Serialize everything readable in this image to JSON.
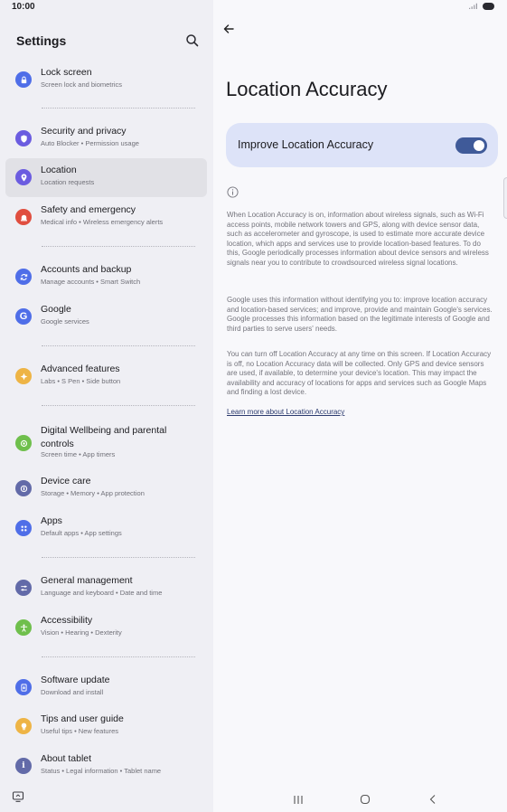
{
  "status_bar": {
    "time": "10:00"
  },
  "settings": {
    "title": "Settings",
    "items": [
      {
        "name": "lock-screen",
        "title": "Lock screen",
        "subtitle": "Screen lock and biometrics",
        "icon": "lock-icon",
        "color": "#4f6ee8"
      },
      {
        "name": "security-privacy",
        "title": "Security and privacy",
        "subtitle": "Auto Blocker  •  Permission usage",
        "icon": "shield-icon",
        "color": "#6b5ce0"
      },
      {
        "name": "location",
        "title": "Location",
        "subtitle": "Location requests",
        "icon": "location-pin-icon",
        "color": "#6b5ce0"
      },
      {
        "name": "safety-emergency",
        "title": "Safety and emergency",
        "subtitle": "Medical info  •  Wireless emergency alerts",
        "icon": "emergency-icon",
        "color": "#e04e3f"
      },
      {
        "name": "accounts-backup",
        "title": "Accounts and backup",
        "subtitle": "Manage accounts  •  Smart Switch",
        "icon": "sync-icon",
        "color": "#4f6ee8"
      },
      {
        "name": "google",
        "title": "Google",
        "subtitle": "Google services",
        "icon": "google-icon",
        "color": "#4f6ee8"
      },
      {
        "name": "advanced-features",
        "title": "Advanced features",
        "subtitle": "Labs  •  S Pen  •  Side button",
        "icon": "star-icon",
        "color": "#eeb445"
      },
      {
        "name": "digital-wellbeing",
        "title": "Digital Wellbeing and parental controls",
        "subtitle": "Screen time  •  App timers",
        "icon": "wellbeing-icon",
        "color": "#6fbf4c"
      },
      {
        "name": "device-care",
        "title": "Device care",
        "subtitle": "Storage  •  Memory  •  App protection",
        "icon": "device-care-icon",
        "color": "#626aa8"
      },
      {
        "name": "apps",
        "title": "Apps",
        "subtitle": "Default apps  •  App settings",
        "icon": "apps-grid-icon",
        "color": "#4f6ee8"
      },
      {
        "name": "general-management",
        "title": "General management",
        "subtitle": "Language and keyboard  •  Date and time",
        "icon": "sliders-icon",
        "color": "#626aa8"
      },
      {
        "name": "accessibility",
        "title": "Accessibility",
        "subtitle": "Vision  •  Hearing  •  Dexterity",
        "icon": "accessibility-icon",
        "color": "#6fbf4c"
      },
      {
        "name": "software-update",
        "title": "Software update",
        "subtitle": "Download and install",
        "icon": "update-icon",
        "color": "#4f6ee8"
      },
      {
        "name": "tips-guide",
        "title": "Tips and user guide",
        "subtitle": "Useful tips  •  New features",
        "icon": "bulb-icon",
        "color": "#eeb445"
      },
      {
        "name": "about-tablet",
        "title": "About tablet",
        "subtitle": "Status  •  Legal information  •  Tablet name",
        "icon": "info-icon",
        "color": "#626aa8"
      }
    ]
  },
  "detail": {
    "title": "Location Accuracy",
    "toggle_label": "Improve Location Accuracy",
    "toggle_on": true,
    "paragraphs": [
      "When Location Accuracy is on, information about wireless signals, such as Wi-Fi access points, mobile network towers and GPS, along with device sensor data, such as accelerometer and gyroscope, is used to estimate more accurate device location, which apps and services use to provide location-based features. To do this, Google periodically processes information about device sensors and wireless signals near you to contribute to crowdsourced wireless signal locations.",
      "Google uses this information without identifying you to: improve location accuracy and location-based services; and improve, provide and maintain Google's services. Google processes this information based on the legitimate interests of Google and third parties to serve users' needs.",
      "You can turn off Location Accuracy at any time on this screen. If Location Accuracy is off, no Location Accuracy data will be collected. Only GPS and device sensors are used, if available, to determine your device's location. This may impact the availability and accuracy of locations for apps and services such as Google Maps and finding a lost device."
    ],
    "link_text": "Learn more about Location Accuracy"
  },
  "colors": {
    "accent": "#3f5a99",
    "card": "#dde3f8",
    "selected": "#e1e1e6"
  }
}
